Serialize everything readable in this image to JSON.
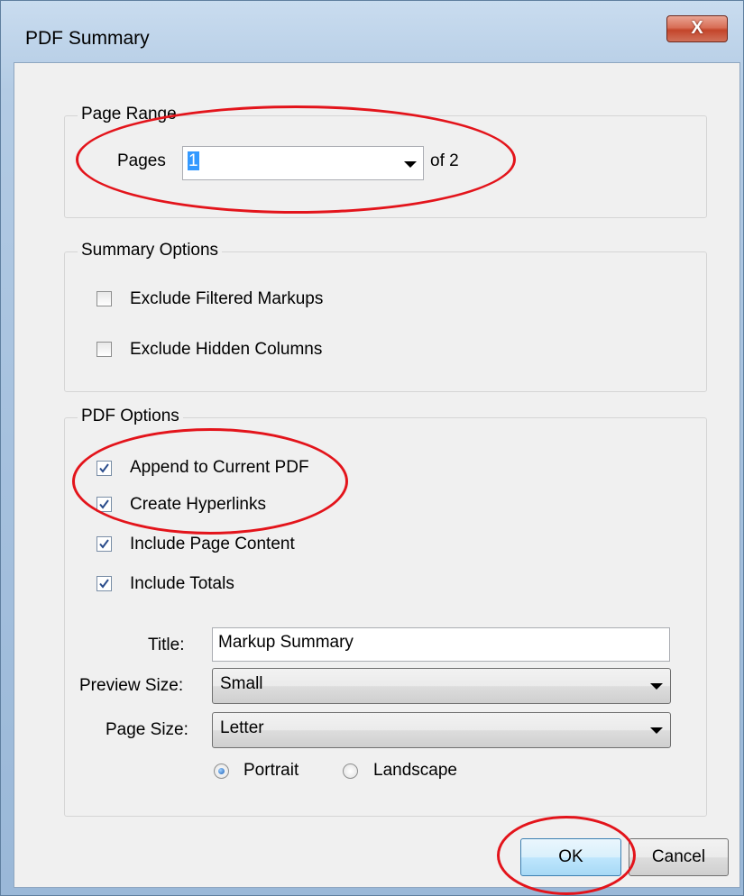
{
  "window": {
    "title": "PDF Summary",
    "close_label": "X"
  },
  "page_range": {
    "group_label": "Page Range",
    "pages_label": "Pages",
    "pages_value": "1",
    "of_label": "of 2"
  },
  "summary_options": {
    "group_label": "Summary Options",
    "items": [
      {
        "label": "Exclude Filtered Markups",
        "checked": false
      },
      {
        "label": "Exclude Hidden Columns",
        "checked": false
      }
    ]
  },
  "pdf_options": {
    "group_label": "PDF Options",
    "items": [
      {
        "label": "Append to Current PDF",
        "checked": true
      },
      {
        "label": "Create Hyperlinks",
        "checked": true
      },
      {
        "label": "Include Page Content",
        "checked": true
      },
      {
        "label": "Include Totals",
        "checked": true
      }
    ],
    "title_label": "Title:",
    "title_value": "Markup Summary",
    "preview_size_label": "Preview Size:",
    "preview_size_value": "Small",
    "page_size_label": "Page Size:",
    "page_size_value": "Letter",
    "orientation": {
      "portrait_label": "Portrait",
      "landscape_label": "Landscape",
      "selected": "Portrait"
    }
  },
  "buttons": {
    "ok_label": "OK",
    "cancel_label": "Cancel"
  },
  "colors": {
    "annotation": "#e3141b",
    "selection": "#3399ff",
    "dialog_bg": "#f0f0f0"
  }
}
